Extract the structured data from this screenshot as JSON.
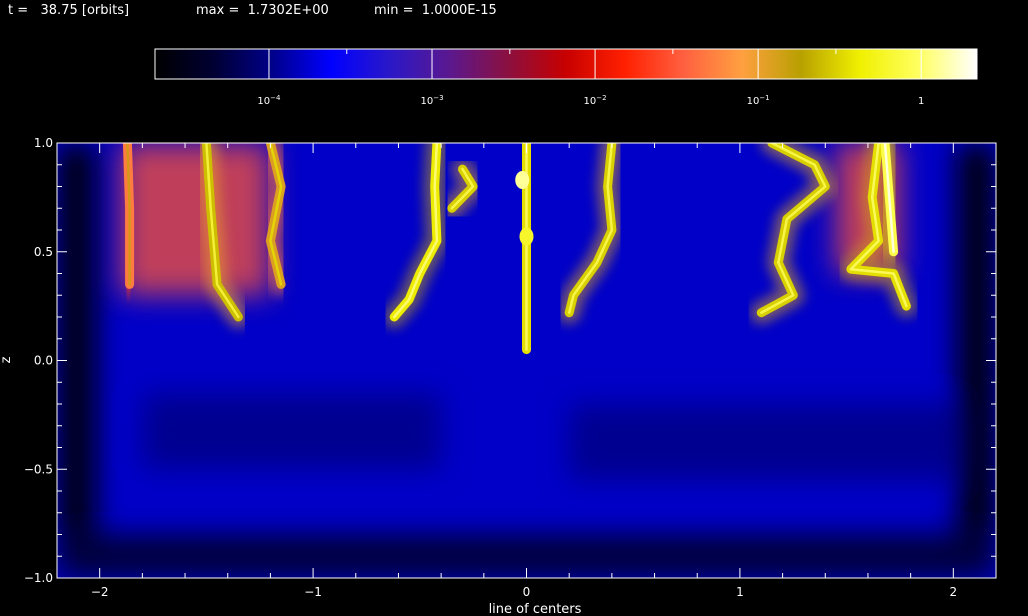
{
  "header": {
    "time_text": "t =   38.75 [orbits]",
    "max_text": "max =  1.7302E+00",
    "min_text": "min =  1.0000E-15"
  },
  "colorbar": {
    "scale": "log",
    "range": [
      2e-05,
      2.2
    ],
    "colors": [
      "#000000",
      "#000033",
      "#00008a",
      "#0000ff",
      "#2a18c8",
      "#5a1890",
      "#8a1040",
      "#c80000",
      "#ff2000",
      "#ff6040",
      "#ffa040",
      "#b8a000",
      "#f0f000",
      "#ffff60",
      "#ffffff"
    ],
    "tick_labels": [
      {
        "value": 0.0001,
        "base": "10",
        "exp": "−4"
      },
      {
        "value": 0.001,
        "base": "10",
        "exp": "−3"
      },
      {
        "value": 0.01,
        "base": "10",
        "exp": "−2"
      },
      {
        "value": 0.1,
        "base": "10",
        "exp": "−1"
      },
      {
        "value": 1,
        "base": "1",
        "exp": ""
      }
    ]
  },
  "chart_data": {
    "type": "heatmap",
    "title": "",
    "xlabel": "line of centers",
    "ylabel": "z",
    "xlim": [
      -2.2,
      2.2
    ],
    "ylim": [
      -1.0,
      1.0
    ],
    "xticks": [
      -2,
      -1,
      0,
      1,
      2
    ],
    "xtick_labels": [
      "−2",
      "−1",
      "0",
      "1",
      "2"
    ],
    "yticks": [
      -1.0,
      -0.5,
      0.0,
      0.5,
      1.0
    ],
    "ytick_labels": [
      "−1.0",
      "−0.5",
      "0.0",
      "0.5",
      "1.0"
    ],
    "x_minor_step": 0.2,
    "y_minor_step": 0.1,
    "background_color": "#0000c8",
    "dark_regions": [
      {
        "x_range": [
          -2.2,
          -2.02
        ],
        "z_range": [
          -1.0,
          1.0
        ],
        "color": "#000010"
      },
      {
        "x_range": [
          2.02,
          2.2
        ],
        "z_range": [
          -1.0,
          1.0
        ],
        "color": "#000010"
      },
      {
        "x_range": [
          -2.2,
          2.2
        ],
        "z_range": [
          -1.0,
          -0.8
        ],
        "color": "#00003a"
      },
      {
        "x_range": [
          -1.8,
          -0.4
        ],
        "z_range": [
          -0.5,
          -0.15
        ],
        "color": "#000090"
      },
      {
        "x_range": [
          0.2,
          2.0
        ],
        "z_range": [
          -0.55,
          -0.2
        ],
        "color": "#000090"
      }
    ],
    "hot_filaments": [
      {
        "points": [
          [
            -1.87,
            1.0
          ],
          [
            -1.86,
            0.7
          ],
          [
            -1.86,
            0.35
          ]
        ],
        "value": 0.05
      },
      {
        "points": [
          [
            -1.5,
            1.0
          ],
          [
            -1.48,
            0.7
          ],
          [
            -1.45,
            0.35
          ],
          [
            -1.35,
            0.2
          ]
        ],
        "value": 0.25
      },
      {
        "points": [
          [
            -1.2,
            1.0
          ],
          [
            -1.15,
            0.8
          ],
          [
            -1.2,
            0.55
          ],
          [
            -1.15,
            0.35
          ]
        ],
        "value": 0.12
      },
      {
        "points": [
          [
            -0.42,
            1.0
          ],
          [
            -0.43,
            0.8
          ],
          [
            -0.42,
            0.55
          ],
          [
            -0.5,
            0.4
          ],
          [
            -0.55,
            0.28
          ],
          [
            -0.62,
            0.2
          ]
        ],
        "value": 0.4
      },
      {
        "points": [
          [
            -0.3,
            0.88
          ],
          [
            -0.25,
            0.8
          ],
          [
            -0.35,
            0.7
          ]
        ],
        "value": 0.3
      },
      {
        "points": [
          [
            0.0,
            1.0
          ],
          [
            0.0,
            0.6
          ],
          [
            0.0,
            0.3
          ],
          [
            0.0,
            0.05
          ]
        ],
        "value": 0.35
      },
      {
        "points": [
          [
            0.4,
            1.0
          ],
          [
            0.38,
            0.8
          ],
          [
            0.4,
            0.6
          ],
          [
            0.33,
            0.45
          ],
          [
            0.22,
            0.3
          ],
          [
            0.2,
            0.22
          ]
        ],
        "value": 0.3
      },
      {
        "points": [
          [
            1.15,
            1.0
          ],
          [
            1.35,
            0.9
          ],
          [
            1.4,
            0.8
          ],
          [
            1.22,
            0.65
          ],
          [
            1.18,
            0.45
          ],
          [
            1.25,
            0.3
          ],
          [
            1.1,
            0.22
          ]
        ],
        "value": 0.3
      },
      {
        "points": [
          [
            1.65,
            1.0
          ],
          [
            1.62,
            0.75
          ],
          [
            1.65,
            0.55
          ],
          [
            1.52,
            0.42
          ],
          [
            1.72,
            0.4
          ],
          [
            1.78,
            0.25
          ]
        ],
        "value": 0.35
      },
      {
        "points": [
          [
            1.68,
            1.0
          ],
          [
            1.7,
            0.75
          ],
          [
            1.72,
            0.5
          ]
        ],
        "value": 0.8
      }
    ],
    "warm_regions": [
      {
        "x_range": [
          -1.9,
          -1.2
        ],
        "z_range": [
          0.3,
          1.0
        ],
        "value": 0.03
      },
      {
        "x_range": [
          1.45,
          1.75
        ],
        "z_range": [
          0.4,
          1.0
        ],
        "value": 0.03
      }
    ],
    "hot_spots": [
      {
        "x": -0.02,
        "z": 0.83,
        "value": 1.3
      },
      {
        "x": 0.0,
        "z": 0.57,
        "value": 0.6
      }
    ]
  }
}
